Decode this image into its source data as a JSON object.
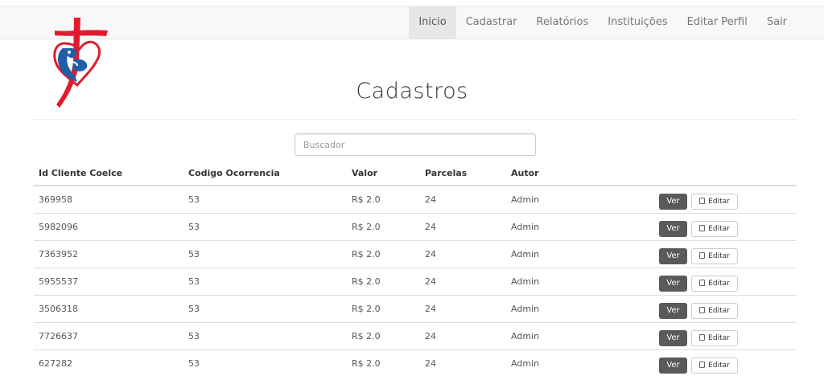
{
  "nav": {
    "items": [
      {
        "label": "Inicio",
        "active": true
      },
      {
        "label": "Cadastrar",
        "active": false
      },
      {
        "label": "Relatórios",
        "active": false
      },
      {
        "label": "Instituições",
        "active": false
      },
      {
        "label": "Editar Perfil",
        "active": false
      },
      {
        "label": "Sair",
        "active": false
      }
    ]
  },
  "page": {
    "title": "Cadastros"
  },
  "search": {
    "placeholder": "Buscador",
    "value": ""
  },
  "table": {
    "headers": [
      "Id Cliente Coelce",
      "Codigo Ocorrencia",
      "Valor",
      "Parcelas",
      "Autor"
    ],
    "rows": [
      {
        "id": "369958",
        "codigo": "53",
        "valor": "R$ 2.0",
        "parcelas": "24",
        "autor": "Admin"
      },
      {
        "id": "5982096",
        "codigo": "53",
        "valor": "R$ 2.0",
        "parcelas": "24",
        "autor": "Admin"
      },
      {
        "id": "7363952",
        "codigo": "53",
        "valor": "R$ 2.0",
        "parcelas": "24",
        "autor": "Admin"
      },
      {
        "id": "5955537",
        "codigo": "53",
        "valor": "R$ 2.0",
        "parcelas": "24",
        "autor": "Admin"
      },
      {
        "id": "3506318",
        "codigo": "53",
        "valor": "R$ 2.0",
        "parcelas": "24",
        "autor": "Admin"
      },
      {
        "id": "7726637",
        "codigo": "53",
        "valor": "R$ 2.0",
        "parcelas": "24",
        "autor": "Admin"
      },
      {
        "id": "627282",
        "codigo": "53",
        "valor": "R$ 2.0",
        "parcelas": "24",
        "autor": "Admin"
      }
    ],
    "actions": {
      "view_label": "Ver",
      "edit_label": "Editar",
      "edit_icon": "pencil-icon"
    }
  },
  "colors": {
    "logo_red": "#e01b2f",
    "logo_blue": "#1f5fa8",
    "button_dark": "#5a5a5a"
  }
}
